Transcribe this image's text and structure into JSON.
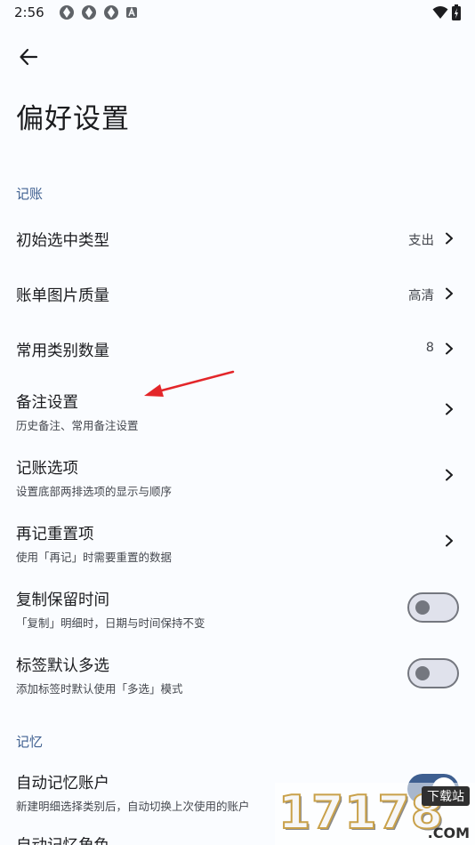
{
  "status_bar": {
    "time": "2:56"
  },
  "page": {
    "title": "偏好设置"
  },
  "sections": {
    "accounting": {
      "header": "记账"
    },
    "memory": {
      "header": "记忆"
    }
  },
  "rows": {
    "initial_type": {
      "title": "初始选中类型",
      "value": "支出"
    },
    "image_quality": {
      "title": "账单图片质量",
      "value": "高清"
    },
    "category_count": {
      "title": "常用类别数量",
      "value": "8"
    },
    "note_settings": {
      "title": "备注设置",
      "subtitle": "历史备注、常用备注设置"
    },
    "accounting_options": {
      "title": "记账选项",
      "subtitle": "设置底部两排选项的显示与顺序"
    },
    "rerecord_reset": {
      "title": "再记重置项",
      "subtitle": "使用「再记」时需要重置的数据"
    },
    "copy_keep_time": {
      "title": "复制保留时间",
      "subtitle": "「复制」明细时，日期与时间保持不变",
      "enabled": false
    },
    "tag_multi_select": {
      "title": "标签默认多选",
      "subtitle": "添加标签时默认使用「多选」模式",
      "enabled": false
    },
    "auto_remember_account": {
      "title": "自动记忆账户",
      "subtitle": "新建明细选择类别后，自动切换上次使用的账户",
      "enabled": true
    },
    "auto_remember_role": {
      "title": "自动记忆角色"
    }
  },
  "watermark": {
    "text": "17178",
    "badge": "下载站",
    "domain": ".COM"
  },
  "colors": {
    "accent": "#3e5f90",
    "background": "#fafcff",
    "annotation_arrow": "#e3262a"
  }
}
